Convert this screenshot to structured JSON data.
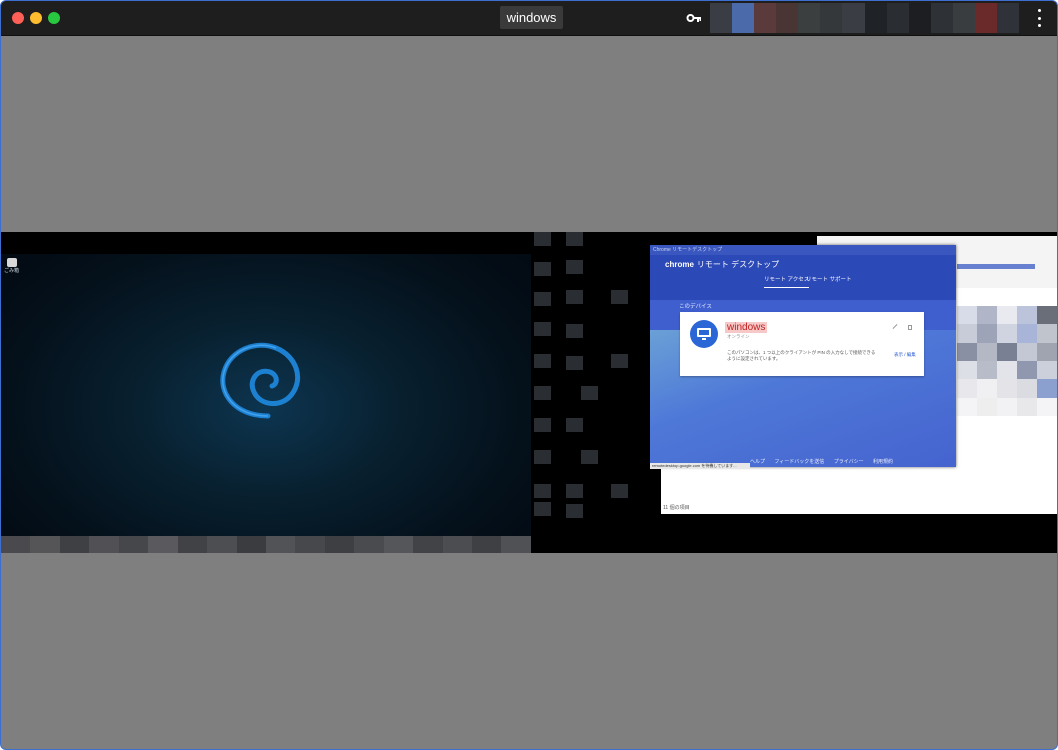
{
  "window": {
    "title": "windows",
    "icons": {
      "key": "key-icon",
      "menu": "more-vert-icon"
    }
  },
  "desktop_left": {
    "icon_label": "ごみ箱"
  },
  "crd": {
    "window_title": "Chrome リモートデスクトップ",
    "app_brand": "chrome",
    "app_name": "リモート デスクトップ",
    "tabs": [
      "リモート アクセス",
      "リモート サポート"
    ],
    "section_title": "このデバイス",
    "device": {
      "name": "windows",
      "status": "オンライン",
      "description": "このパソコンは、1 つ以上のクライアントが PIN の入力なしで接続できるように設定されています。",
      "action": "表示 / 編集"
    },
    "footer_links": [
      "ヘルプ",
      "フィードバックを送信",
      "プライバシー",
      "利用規約"
    ],
    "url": "remotedesktop.google.com を待機しています..."
  },
  "background_windows": {
    "status_text": "11 個の項目"
  },
  "colors": {
    "accent": "#3d6fd0",
    "crd_blue": "#3f5fcf",
    "titlebar": "#1e1e1e",
    "viewer_bg": "#7f7f7f"
  }
}
